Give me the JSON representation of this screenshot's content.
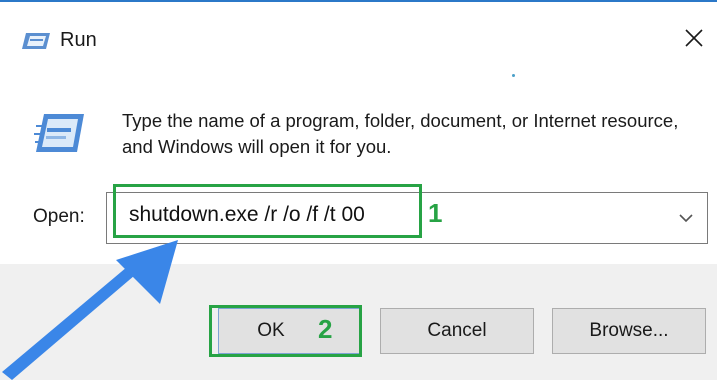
{
  "window": {
    "title": "Run",
    "title_icon": "run-icon",
    "close_icon": "close-icon"
  },
  "body": {
    "app_icon": "run-app-icon",
    "description": "Type the name of a program, folder, document, or Internet resource, and Windows will open it for you."
  },
  "open_field": {
    "label": "Open:",
    "value": "shutdown.exe /r /o /f /t 00",
    "dropdown_icon": "chevron-down-icon"
  },
  "buttons": {
    "ok": "OK",
    "cancel": "Cancel",
    "browse": "Browse..."
  },
  "annotations": {
    "step_1": "1",
    "step_2": "2",
    "highlight_color": "#27a345",
    "arrow_color": "#3a86e8"
  }
}
